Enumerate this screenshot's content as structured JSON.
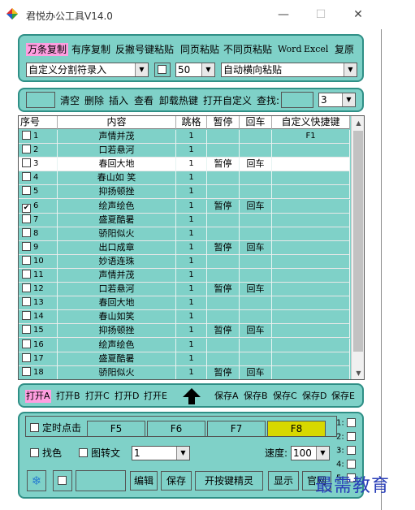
{
  "window": {
    "title": "君悦办公工具V14.0",
    "minimize": "—",
    "maximize": "☐",
    "close": "✕"
  },
  "top_toolbar": {
    "buttons": [
      "万条复制",
      "有序复制",
      "反撇号键粘贴",
      "同页粘贴",
      "不同页粘贴",
      "Word",
      "Excel",
      "复原"
    ],
    "active_button": "万条复制",
    "mode_select": "自定义分割符录入",
    "count_select": "50",
    "paste_select": "自动横向粘贴"
  },
  "tool_bar2": {
    "buttons": [
      "清空",
      "删除",
      "插入",
      "查看",
      "卸载热键",
      "打开自定义"
    ],
    "search_label": "查找:",
    "search_value": "",
    "search_col_select": "3"
  },
  "table": {
    "columns": [
      "序号",
      "内容",
      "跳格",
      "暂停",
      "回车",
      "自定义快捷键"
    ],
    "rows": [
      {
        "id": "1",
        "content": "声情并茂",
        "skip": "1",
        "pause": "",
        "enter": "",
        "hotkey": "F1",
        "checked": false,
        "highlight": false
      },
      {
        "id": "2",
        "content": "口若悬河",
        "skip": "1",
        "pause": "",
        "enter": "",
        "hotkey": "",
        "checked": false,
        "highlight": false
      },
      {
        "id": "3",
        "content": "春回大地",
        "skip": "1",
        "pause": "暂停",
        "enter": "回车",
        "hotkey": "",
        "checked": false,
        "highlight": true
      },
      {
        "id": "4",
        "content": "春山如 笑",
        "skip": "1",
        "pause": "",
        "enter": "",
        "hotkey": "",
        "checked": false,
        "highlight": false
      },
      {
        "id": "5",
        "content": "抑扬顿挫",
        "skip": "1",
        "pause": "",
        "enter": "",
        "hotkey": "",
        "checked": false,
        "highlight": false
      },
      {
        "id": "6",
        "content": "绘声绘色",
        "skip": "1",
        "pause": "暂停",
        "enter": "回车",
        "hotkey": "",
        "checked": true,
        "highlight": false
      },
      {
        "id": "7",
        "content": "盛夏酷暑",
        "skip": "1",
        "pause": "",
        "enter": "",
        "hotkey": "",
        "checked": false,
        "highlight": false
      },
      {
        "id": "8",
        "content": "骄阳似火",
        "skip": "1",
        "pause": "",
        "enter": "",
        "hotkey": "",
        "checked": false,
        "highlight": false
      },
      {
        "id": "9",
        "content": "出口成章",
        "skip": "1",
        "pause": "暂停",
        "enter": "回车",
        "hotkey": "",
        "checked": false,
        "highlight": false
      },
      {
        "id": "10",
        "content": "妙语连珠",
        "skip": "1",
        "pause": "",
        "enter": "",
        "hotkey": "",
        "checked": false,
        "highlight": false
      },
      {
        "id": "11",
        "content": "声情并茂",
        "skip": "1",
        "pause": "",
        "enter": "",
        "hotkey": "",
        "checked": false,
        "highlight": false
      },
      {
        "id": "12",
        "content": "口若悬河",
        "skip": "1",
        "pause": "暂停",
        "enter": "回车",
        "hotkey": "",
        "checked": false,
        "highlight": false
      },
      {
        "id": "13",
        "content": "春回大地",
        "skip": "1",
        "pause": "",
        "enter": "",
        "hotkey": "",
        "checked": false,
        "highlight": false
      },
      {
        "id": "14",
        "content": "春山如笑",
        "skip": "1",
        "pause": "",
        "enter": "",
        "hotkey": "",
        "checked": false,
        "highlight": false
      },
      {
        "id": "15",
        "content": "抑扬顿挫",
        "skip": "1",
        "pause": "暂停",
        "enter": "回车",
        "hotkey": "",
        "checked": false,
        "highlight": false
      },
      {
        "id": "16",
        "content": "绘声绘色",
        "skip": "1",
        "pause": "",
        "enter": "",
        "hotkey": "",
        "checked": false,
        "highlight": false
      },
      {
        "id": "17",
        "content": "盛夏酷暑",
        "skip": "1",
        "pause": "",
        "enter": "",
        "hotkey": "",
        "checked": false,
        "highlight": false
      },
      {
        "id": "18",
        "content": "骄阳似火",
        "skip": "1",
        "pause": "暂停",
        "enter": "回车",
        "hotkey": "",
        "checked": false,
        "highlight": false
      }
    ]
  },
  "file_bar": {
    "open_buttons": [
      "打开A",
      "打开B",
      "打开C",
      "打开D",
      "打开E"
    ],
    "save_buttons": [
      "保存A",
      "保存B",
      "保存C",
      "保存D",
      "保存E"
    ],
    "active_button": "打开A"
  },
  "bottom": {
    "timer_label": "定时点击",
    "fkeys": [
      "F5",
      "F6",
      "F7",
      "F8"
    ],
    "active_fkey": "F8",
    "color_label": "找色",
    "img2text_label": "图转文",
    "mode_select": "1",
    "speed_label": "速度:",
    "speed_select": "100",
    "slots": [
      "1:",
      "2:",
      "3:",
      "4:",
      "5:"
    ],
    "actions": [
      "编辑",
      "保存",
      "开按键精灵",
      "显示",
      "官网"
    ]
  },
  "watermark": "最需教育",
  "colors": {
    "panel": "#7fd1c8",
    "highlight_pink": "#ff9ee0",
    "highlight_yellow": "#d8d800",
    "selected_row": "#ffffff"
  }
}
